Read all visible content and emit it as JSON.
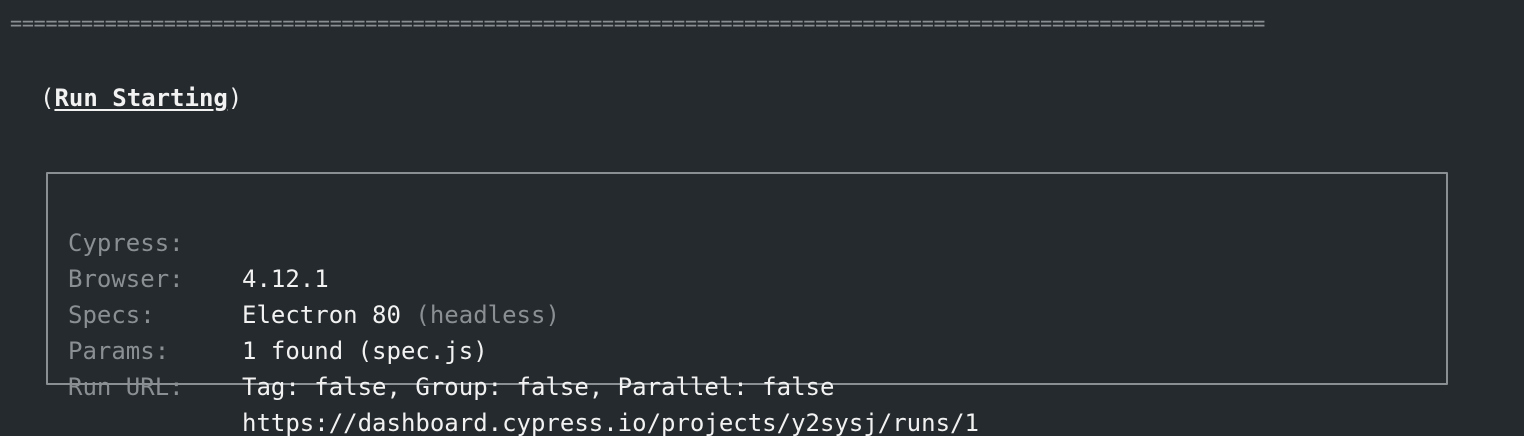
{
  "separator": "==========================================================================================================",
  "heading": {
    "open_paren": "(",
    "title": "Run Starting",
    "close_paren": ")"
  },
  "run_info": {
    "cypress_label": "Cypress:",
    "cypress_value": "4.12.1",
    "browser_label": "Browser:",
    "browser_value": "Electron 80",
    "browser_note": "(headless)",
    "specs_label": "Specs:",
    "specs_value": "1 found (spec.js)",
    "params_label": "Params:",
    "params_value": "Tag: false, Group: false, Parallel: false",
    "run_url_label": "Run URL:",
    "run_url_value": "https://dashboard.cypress.io/projects/y2sysj/runs/1"
  },
  "colors": {
    "background": "#252a2e",
    "text": "#f2f2f2",
    "muted": "#8a8f93"
  }
}
